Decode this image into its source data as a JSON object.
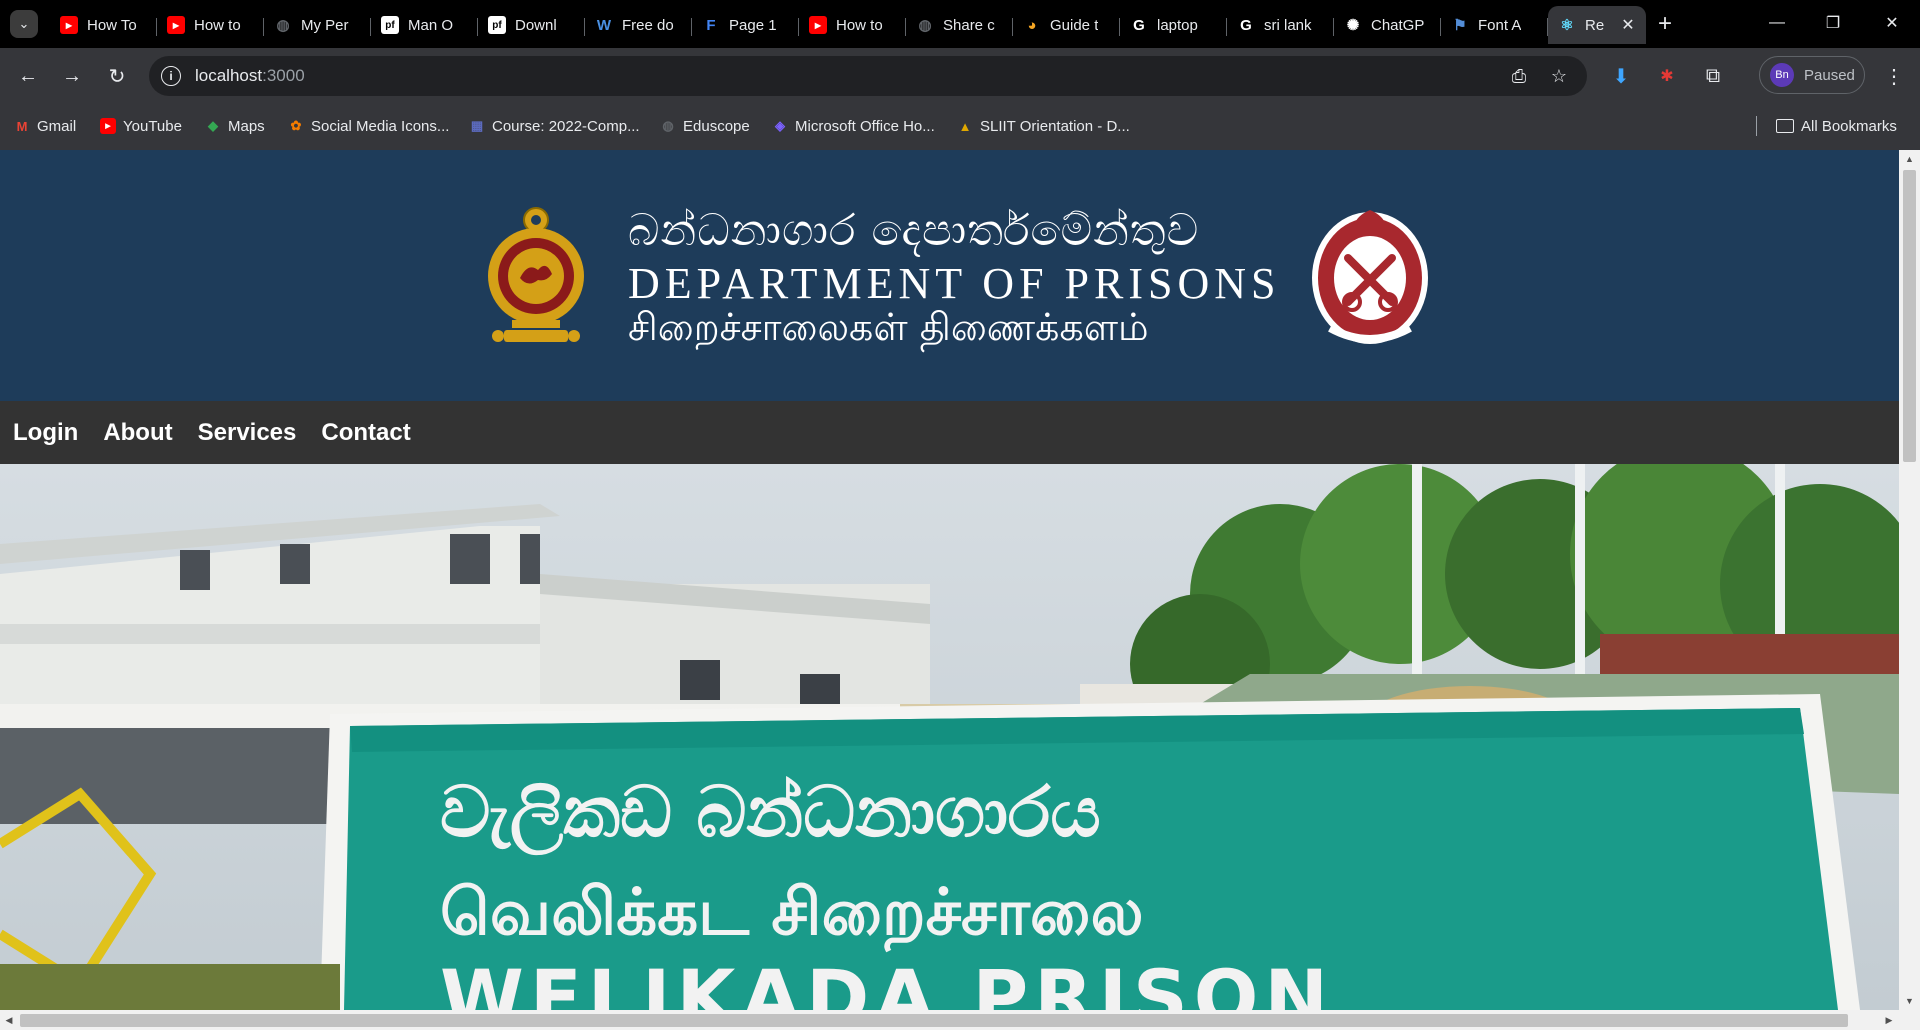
{
  "browser": {
    "tabs": [
      {
        "title": "How To",
        "icon": "youtube-icon",
        "color": "#ff0000"
      },
      {
        "title": "How to",
        "icon": "youtube-icon",
        "color": "#ff0000"
      },
      {
        "title": "My Per",
        "icon": "globe-icon",
        "color": "#5f6368"
      },
      {
        "title": "Man O",
        "icon": "pf-icon",
        "color": "#ffffff"
      },
      {
        "title": "Downl",
        "icon": "pf-icon",
        "color": "#ffffff"
      },
      {
        "title": "Free do",
        "icon": "w-icon",
        "color": "#4a90e2"
      },
      {
        "title": "Page 1",
        "icon": "forms-icon",
        "color": "#4285f4"
      },
      {
        "title": "How to",
        "icon": "youtube-icon",
        "color": "#ff0000"
      },
      {
        "title": "Share c",
        "icon": "globe-icon",
        "color": "#5f6368"
      },
      {
        "title": "Guide t",
        "icon": "monkey-icon",
        "color": "#f5a623"
      },
      {
        "title": "laptop",
        "icon": "google-icon",
        "color": "#ffffff"
      },
      {
        "title": "sri lank",
        "icon": "google-icon",
        "color": "#ffffff"
      },
      {
        "title": "ChatGP",
        "icon": "chatgpt-icon",
        "color": "#ffffff"
      },
      {
        "title": "Font A",
        "icon": "flag-icon",
        "color": "#538dd7"
      },
      {
        "title": "Re",
        "icon": "react-icon",
        "color": "#61dafb",
        "active": true
      }
    ],
    "url": {
      "host": "localhost",
      "port": ":3000"
    },
    "profile": {
      "initials": "Bn",
      "status": "Paused",
      "color": "#5c3ab7"
    },
    "bookmarks": [
      {
        "label": "Gmail",
        "icon": "gmail-icon",
        "color": "#ea4335"
      },
      {
        "label": "YouTube",
        "icon": "youtube-icon",
        "color": "#ff0000"
      },
      {
        "label": "Maps",
        "icon": "maps-icon",
        "color": "#34a853"
      },
      {
        "label": "Social Media Icons...",
        "icon": "social-icon",
        "color": "#f57c00"
      },
      {
        "label": "Course: 2022-Comp...",
        "icon": "course-icon",
        "color": "#5c6bc0"
      },
      {
        "label": "Eduscope",
        "icon": "globe-icon",
        "color": "#5f6368"
      },
      {
        "label": "Microsoft Office Ho...",
        "icon": "office-icon",
        "color": "#7b61ff"
      },
      {
        "label": "SLIIT Orientation - D...",
        "icon": "sliit-icon",
        "color": "#e0a800"
      }
    ],
    "all_bookmarks_label": "All Bookmarks"
  },
  "site": {
    "banner": {
      "sinhala": "බන්ධනාගාර දෙපාර්තමේන්තුව",
      "english": "DEPARTMENT OF PRISONS",
      "tamil": "சிறைச்சாலைகள் திணைக்களம்"
    },
    "nav": {
      "login": "Login",
      "about": "About",
      "services": "Services",
      "contact": "Contact"
    },
    "hero": {
      "sign_line1": "වැලිකඩ  බන්ධනාගාරය",
      "sign_line2": "வெலிக்கட  சிறைச்சாலை",
      "sign_line3": "WELIKADA PRISON"
    },
    "colors": {
      "header_bg": "#1e3c5a",
      "nav_bg": "#333333",
      "sign_green": "#1a9b8a"
    }
  }
}
